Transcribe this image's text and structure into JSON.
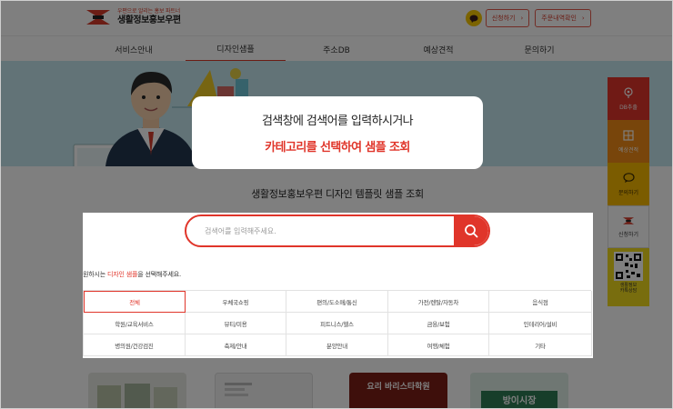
{
  "header": {
    "logo_sub": "우편으로 알리는 홍보 파트너",
    "logo_main": "생활정보홍보우편",
    "btn_apply": "신청하기",
    "btn_history": "주문내역확인"
  },
  "nav": {
    "items": [
      "서비스안내",
      "디자인샘플",
      "주소DB",
      "예상견적",
      "문의하기"
    ],
    "active_index": 1
  },
  "side_menu": {
    "items": [
      {
        "label": "DB추출",
        "icon": "location-pin-icon",
        "color": "#e0352a"
      },
      {
        "label": "예상견적",
        "icon": "calculator-icon",
        "color": "#f08a17"
      },
      {
        "label": "문의하기",
        "icon": "chat-icon",
        "color": "#f7b800"
      },
      {
        "label": "신청하기",
        "icon": "logo-mark-icon",
        "color": "#ffffff"
      }
    ],
    "qr_caption": "생활정보\n카톡상담"
  },
  "section_title": "생활정보홍보우편 디자인 템플릿 샘플 조회",
  "tooltip": {
    "line1": "검색창에 검색어를 입력하시거나",
    "line2": "카테고리를 선택하여 샘플 조회"
  },
  "search": {
    "placeholder": "검색어를 입력해주세요.",
    "value": ""
  },
  "guide": {
    "prefix": "원하시는 ",
    "highlight": "디자인 샘플",
    "suffix": "을 선택해주세요."
  },
  "categories": [
    "전체",
    "우체국쇼핑",
    "편의/도소매/통신",
    "가전/렌탈/자동차",
    "음식점",
    "학원/교육서비스",
    "뷰티/미용",
    "피트니스/헬스",
    "금융/보험",
    "인테리어/설비",
    "병의원/건강검진",
    "축제/안내",
    "분양안내",
    "여행/체험",
    "기타"
  ],
  "active_category": 0,
  "thumbs": [
    "",
    "",
    "요리 바리스타학원",
    "방이시장"
  ],
  "colors": {
    "accent": "#e0352a",
    "hero_bg": "#c4e7ef",
    "kakao": "#f7c600"
  }
}
